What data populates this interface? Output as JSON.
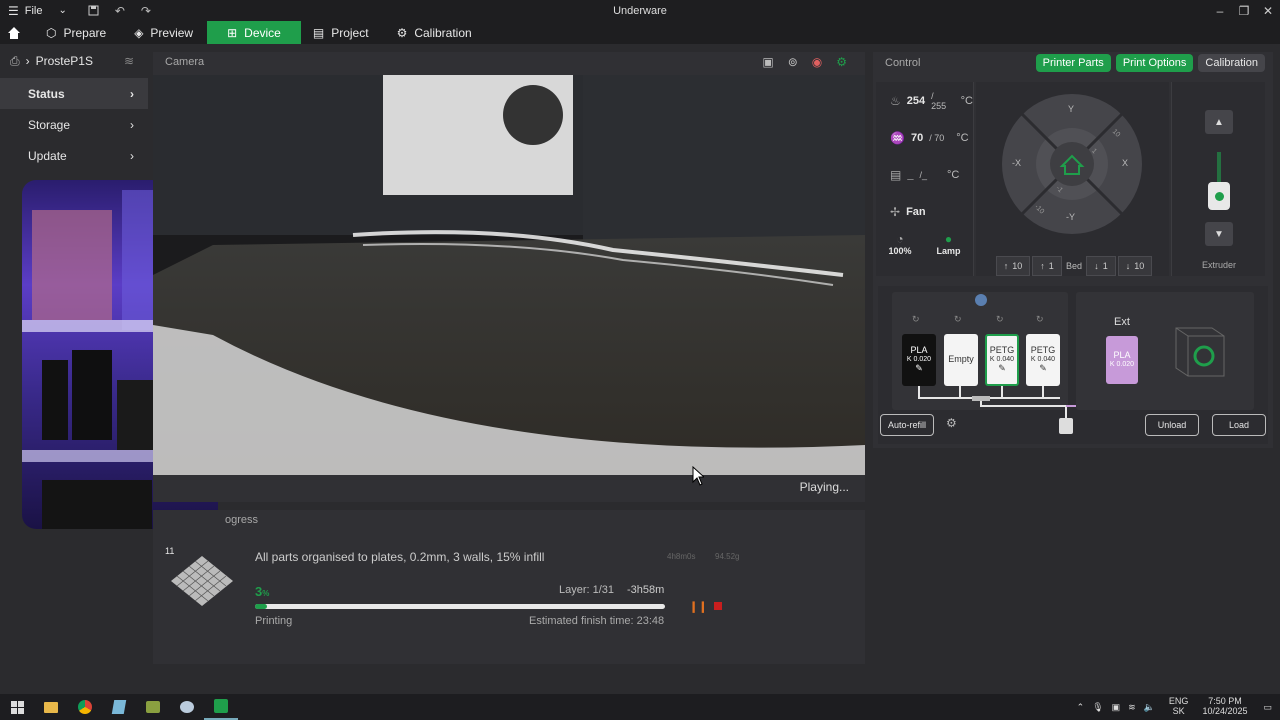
{
  "titlebar": {
    "file_label": "File",
    "app_title": "Underware"
  },
  "nav": {
    "tabs": [
      {
        "label": "Prepare"
      },
      {
        "label": "Preview"
      },
      {
        "label": "Device"
      },
      {
        "label": "Project"
      },
      {
        "label": "Calibration"
      }
    ]
  },
  "sidebar": {
    "printer_name": "ProsteP1S",
    "items": [
      {
        "label": "Status"
      },
      {
        "label": "Storage"
      },
      {
        "label": "Update"
      }
    ]
  },
  "camera": {
    "title": "Camera",
    "status": "Playing..."
  },
  "progress": {
    "title": "ogress",
    "plate_number": "11",
    "job_name": "All parts organised to plates, 0.2mm, 3 walls, 15% infill",
    "print_time": "4h8m0s",
    "weight": "94.52g",
    "percent": "3",
    "percent_unit": "%",
    "percent_value": 3,
    "layer": "Layer: 1/31",
    "remaining": "-3h58m",
    "state": "Printing",
    "finish": "Estimated finish time: 23:48"
  },
  "control": {
    "title": "Control",
    "buttons": {
      "printer_parts": "Printer Parts",
      "print_options": "Print Options",
      "calibration": "Calibration"
    },
    "nozzle": {
      "current": "254",
      "target": "/ 255",
      "unit": "°C"
    },
    "bed": {
      "current": "70",
      "target": "/ 70",
      "unit": "°C"
    },
    "chamber": {
      "current": "_",
      "target": "/_",
      "unit": "°C"
    },
    "fan": {
      "label": "Fan",
      "speed": "100%",
      "lamp_label": "Lamp"
    },
    "jog": {
      "y_plus": "Y",
      "y_minus": "-Y",
      "x_plus": "X",
      "x_minus": "-X",
      "p10": "10",
      "p1": "1",
      "m1": "-1",
      "m10": "-10"
    },
    "bed_move": {
      "up10": "10",
      "up1": "1",
      "label": "Bed",
      "down1": "1",
      "down10": "10"
    },
    "extruder_label": "Extruder",
    "ams": {
      "slots": [
        {
          "type": "PLA",
          "k": "K 0.020"
        },
        {
          "type": "Empty",
          "k": ""
        },
        {
          "type": "PETG",
          "k": "K 0.040"
        },
        {
          "type": "PETG",
          "k": "K 0.040"
        }
      ],
      "ext_label": "Ext",
      "ext_slot": {
        "type": "PLA",
        "k": "K 0.020"
      },
      "auto_refill": "Auto-refill",
      "unload": "Unload",
      "load": "Load"
    }
  },
  "taskbar": {
    "lang1": "ENG",
    "lang2": "SK",
    "time": "7:50 PM",
    "date": "10/24/2025"
  },
  "colors": {
    "accent": "#1f9e4b",
    "slot_pla_black": "#111111",
    "slot_ext_pla": "#c79ad9"
  }
}
